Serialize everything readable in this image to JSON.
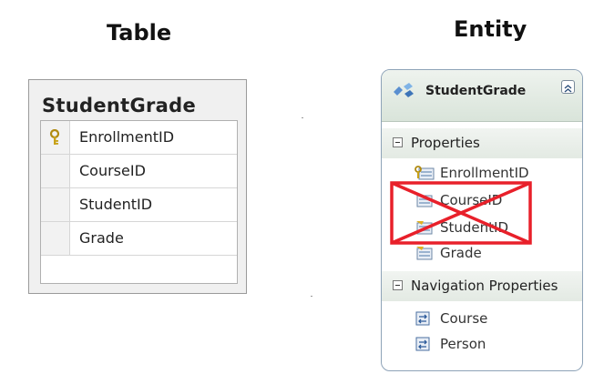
{
  "table_heading": "Table",
  "entity_heading": "Entity",
  "table": {
    "name": "StudentGrade",
    "columns": [
      "EnrollmentID",
      "CourseID",
      "StudentID",
      "Grade"
    ],
    "primary_key": "EnrollmentID"
  },
  "entity": {
    "name": "StudentGrade",
    "properties_header": "Properties",
    "properties": [
      "EnrollmentID",
      "CourseID",
      "StudentID",
      "Grade"
    ],
    "removed_properties": [
      "CourseID",
      "StudentID"
    ],
    "navigation_header": "Navigation Properties",
    "navigation_properties": [
      "Course",
      "Person"
    ]
  },
  "colors": {
    "strike": "#e8202a",
    "key": "#c8a21a",
    "header_green": "#d9e4da"
  }
}
